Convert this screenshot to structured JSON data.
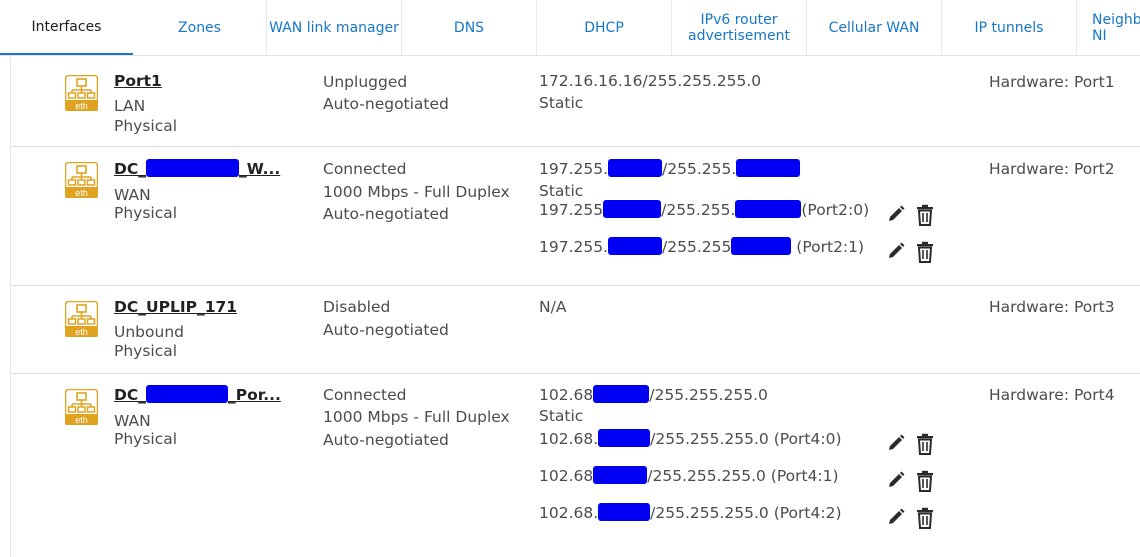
{
  "tabs": [
    {
      "label": "Interfaces",
      "active": true
    },
    {
      "label": "Zones"
    },
    {
      "label": "WAN link manager"
    },
    {
      "label": "DNS"
    },
    {
      "label": "DHCP"
    },
    {
      "label": "IPv6 router advertisement"
    },
    {
      "label": "Cellular WAN"
    },
    {
      "label": "IP tunnels"
    },
    {
      "label": "Neighbo\nNI"
    }
  ],
  "icon_label": "eth",
  "rows": [
    {
      "name": "Port1",
      "zone": "LAN",
      "type": "Physical",
      "status": "Unplugged",
      "speed": "",
      "negotiation": "Auto-negotiated",
      "ip": "172.16.16.16/255.255.255.0",
      "mode": "Static",
      "hardware": "Hardware:  Port1",
      "aliases": []
    },
    {
      "name_a": "DC_",
      "name_b": "_W...",
      "zone": "WAN",
      "type": "Physical",
      "status": "Connected",
      "speed": "1000 Mbps - Full Duplex",
      "negotiation": "Auto-negotiated",
      "ip_a": "197.255.",
      "ip_b": "/255.255.",
      "mode": "Static",
      "hardware": "Hardware:  Port2",
      "aliases": [
        {
          "a": "197.255",
          "b": "/255.255.",
          "c": "(Port2:0)"
        },
        {
          "a": "197.255.",
          "b": "/255.255",
          "c": "(Port2:1)"
        }
      ]
    },
    {
      "name": "DC_UPLIP_171",
      "zone": "Unbound",
      "type": "Physical",
      "status": "Disabled",
      "speed": "",
      "negotiation": "Auto-negotiated",
      "ip": "N/A",
      "mode": "",
      "hardware": "Hardware:  Port3",
      "aliases": []
    },
    {
      "name_a": "DC_",
      "name_b": "_Por...",
      "zone": "WAN",
      "type": "Physical",
      "status": "Connected",
      "speed": "1000 Mbps - Full Duplex",
      "negotiation": "Auto-negotiated",
      "ip_a": "102.68",
      "ip_b": "/255.255.255.0",
      "mode": "Static",
      "hardware": "Hardware:  Port4",
      "aliases": [
        {
          "a": "102.68.",
          "b": "/255.255.255.0 (Port4:0)"
        },
        {
          "a": "102.68",
          "b": "/255.255.255.0 (Port4:1)"
        },
        {
          "a": "102.68.",
          "b": "/255.255.255.0 (Port4:2)"
        }
      ]
    }
  ],
  "colors": {
    "accent": "#1677c9",
    "icon": "#e0a321",
    "redaction": "#0000f4"
  }
}
